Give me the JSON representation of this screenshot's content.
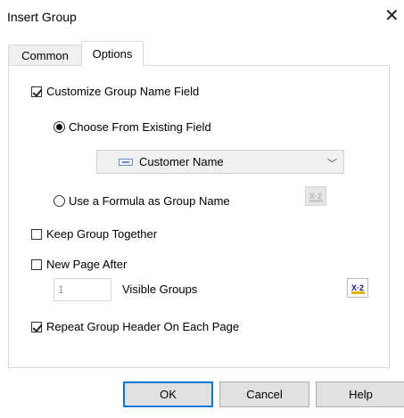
{
  "window": {
    "title": "Insert Group",
    "close_glyph": "✕"
  },
  "tabs": [
    {
      "label": "Common",
      "selected": false
    },
    {
      "label": "Options",
      "selected": true
    }
  ],
  "options": {
    "customize_group_name": {
      "label": "Customize Group Name Field",
      "checked": true
    },
    "choose_existing": {
      "label": "Choose From Existing Field",
      "selected": true
    },
    "field_combo": {
      "value": "Customer Name"
    },
    "use_formula": {
      "label": "Use a Formula as Group Name",
      "selected": false
    },
    "formula_icon_text": "X·2",
    "keep_together": {
      "label": "Keep Group Together",
      "checked": false
    },
    "new_page_after": {
      "label": "New Page After",
      "checked": false
    },
    "visible_groups_value": "1",
    "visible_groups_label": "Visible Groups",
    "repeat_header": {
      "label": "Repeat Group Header On Each Page",
      "checked": true
    }
  },
  "buttons": {
    "ok": "OK",
    "cancel": "Cancel",
    "help": "Help"
  }
}
